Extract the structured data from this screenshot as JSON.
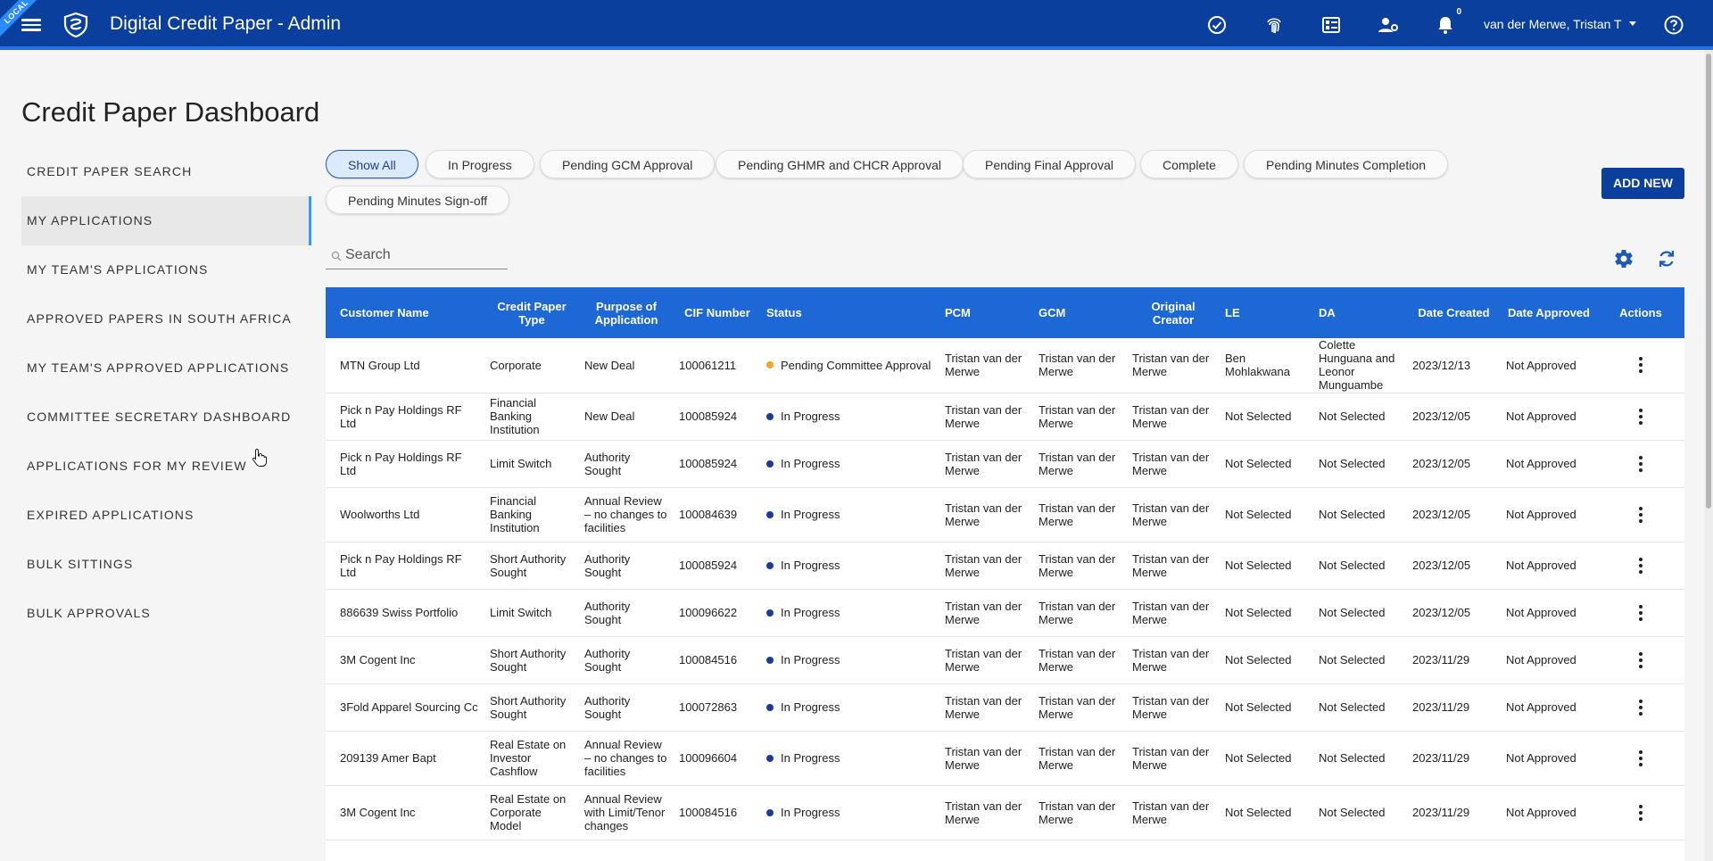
{
  "header": {
    "env_badge": "LOCAL",
    "title": "Digital Credit Paper - Admin",
    "notification_count": "0",
    "user_name": "van der Merwe, Tristan T",
    "brand_color": "#0b3f9e"
  },
  "page": {
    "title": "Credit Paper Dashboard"
  },
  "sidebar": {
    "items": [
      {
        "label": "CREDIT PAPER SEARCH"
      },
      {
        "label": "MY APPLICATIONS"
      },
      {
        "label": "MY TEAM'S APPLICATIONS"
      },
      {
        "label": "APPROVED PAPERS IN SOUTH AFRICA"
      },
      {
        "label": "MY TEAM'S APPROVED APPLICATIONS"
      },
      {
        "label": "COMMITTEE SECRETARY DASHBOARD"
      },
      {
        "label": "APPLICATIONS FOR MY REVIEW"
      },
      {
        "label": "EXPIRED APPLICATIONS"
      },
      {
        "label": "BULK SITTINGS"
      },
      {
        "label": "BULK APPROVALS"
      }
    ],
    "active": "MY APPLICATIONS"
  },
  "filters": {
    "chips": [
      {
        "label": "Show All"
      },
      {
        "label": "In Progress"
      },
      {
        "label": "Pending GCM Approval"
      },
      {
        "label": "Pending GHMR and CHCR Approval"
      },
      {
        "label": "Pending Final Approval"
      },
      {
        "label": "Complete"
      },
      {
        "label": "Pending Minutes Completion"
      },
      {
        "label": "Pending Minutes Sign-off"
      }
    ],
    "selected": "Show All"
  },
  "toolbar": {
    "add_new_label": "ADD NEW",
    "search_placeholder": "Search"
  },
  "table": {
    "columns": [
      "Customer Name",
      "Credit Paper Type",
      "Purpose of Application",
      "CIF Number",
      "Status",
      "PCM",
      "GCM",
      "Original Creator",
      "LE",
      "DA",
      "Date Created",
      "Date Approved",
      "Actions"
    ],
    "rows": [
      {
        "customer": "MTN Group Ltd",
        "type": "Corporate",
        "purpose": "New Deal",
        "cif": "100061211",
        "status": "Pending Committee Approval",
        "status_color": "#f5a623",
        "pcm": "Tristan van der Merwe",
        "gcm": "Tristan van der Merwe",
        "creator": "Tristan van der Merwe",
        "le": "Ben Mohlakwana",
        "da": "Colette Hunguana and Leonor Munguambe",
        "created": "2023/12/13",
        "approved": "Not Approved"
      },
      {
        "customer": "Pick n Pay Holdings RF Ltd",
        "type": "Financial Banking Institution",
        "purpose": "New Deal",
        "cif": "100085924",
        "status": "In Progress",
        "status_color": "#1a3a9e",
        "pcm": "Tristan van der Merwe",
        "gcm": "Tristan van der Merwe",
        "creator": "Tristan van der Merwe",
        "le": "Not Selected",
        "da": "Not Selected",
        "created": "2023/12/05",
        "approved": "Not Approved"
      },
      {
        "customer": "Pick n Pay Holdings RF Ltd",
        "type": "Limit Switch",
        "purpose": "Authority Sought",
        "cif": "100085924",
        "status": "In Progress",
        "status_color": "#1a3a9e",
        "pcm": "Tristan van der Merwe",
        "gcm": "Tristan van der Merwe",
        "creator": "Tristan van der Merwe",
        "le": "Not Selected",
        "da": "Not Selected",
        "created": "2023/12/05",
        "approved": "Not Approved"
      },
      {
        "customer": "Woolworths Ltd",
        "type": "Financial Banking Institution",
        "purpose": "Annual Review – no changes to facilities",
        "cif": "100084639",
        "status": "In Progress",
        "status_color": "#1a3a9e",
        "pcm": "Tristan van der Merwe",
        "gcm": "Tristan van der Merwe",
        "creator": "Tristan van der Merwe",
        "le": "Not Selected",
        "da": "Not Selected",
        "created": "2023/12/05",
        "approved": "Not Approved"
      },
      {
        "customer": "Pick n Pay Holdings RF Ltd",
        "type": "Short Authority Sought",
        "purpose": "Authority Sought",
        "cif": "100085924",
        "status": "In Progress",
        "status_color": "#1a3a9e",
        "pcm": "Tristan van der Merwe",
        "gcm": "Tristan van der Merwe",
        "creator": "Tristan van der Merwe",
        "le": "Not Selected",
        "da": "Not Selected",
        "created": "2023/12/05",
        "approved": "Not Approved"
      },
      {
        "customer": "886639 Swiss Portfolio",
        "type": "Limit Switch",
        "purpose": "Authority Sought",
        "cif": "100096622",
        "status": "In Progress",
        "status_color": "#1a3a9e",
        "pcm": "Tristan van der Merwe",
        "gcm": "Tristan van der Merwe",
        "creator": "Tristan van der Merwe",
        "le": "Not Selected",
        "da": "Not Selected",
        "created": "2023/12/05",
        "approved": "Not Approved"
      },
      {
        "customer": "3M Cogent Inc",
        "type": "Short Authority Sought",
        "purpose": "Authority Sought",
        "cif": "100084516",
        "status": "In Progress",
        "status_color": "#1a3a9e",
        "pcm": "Tristan van der Merwe",
        "gcm": "Tristan van der Merwe",
        "creator": "Tristan van der Merwe",
        "le": "Not Selected",
        "da": "Not Selected",
        "created": "2023/11/29",
        "approved": "Not Approved"
      },
      {
        "customer": "3Fold Apparel Sourcing Cc",
        "type": "Short Authority Sought",
        "purpose": "Authority Sought",
        "cif": "100072863",
        "status": "In Progress",
        "status_color": "#1a3a9e",
        "pcm": "Tristan van der Merwe",
        "gcm": "Tristan van der Merwe",
        "creator": "Tristan van der Merwe",
        "le": "Not Selected",
        "da": "Not Selected",
        "created": "2023/11/29",
        "approved": "Not Approved"
      },
      {
        "customer": "209139 Amer Bapt",
        "type": "Real Estate on Investor Cashflow",
        "purpose": "Annual Review – no changes to facilities",
        "cif": "100096604",
        "status": "In Progress",
        "status_color": "#1a3a9e",
        "pcm": "Tristan van der Merwe",
        "gcm": "Tristan van der Merwe",
        "creator": "Tristan van der Merwe",
        "le": "Not Selected",
        "da": "Not Selected",
        "created": "2023/11/29",
        "approved": "Not Approved"
      },
      {
        "customer": "3M Cogent Inc",
        "type": "Real Estate on Corporate Model",
        "purpose": "Annual Review with Limit/Tenor changes",
        "cif": "100084516",
        "status": "In Progress",
        "status_color": "#1a3a9e",
        "pcm": "Tristan van der Merwe",
        "gcm": "Tristan van der Merwe",
        "creator": "Tristan van der Merwe",
        "le": "Not Selected",
        "da": "Not Selected",
        "created": "2023/11/29",
        "approved": "Not Approved"
      }
    ]
  }
}
